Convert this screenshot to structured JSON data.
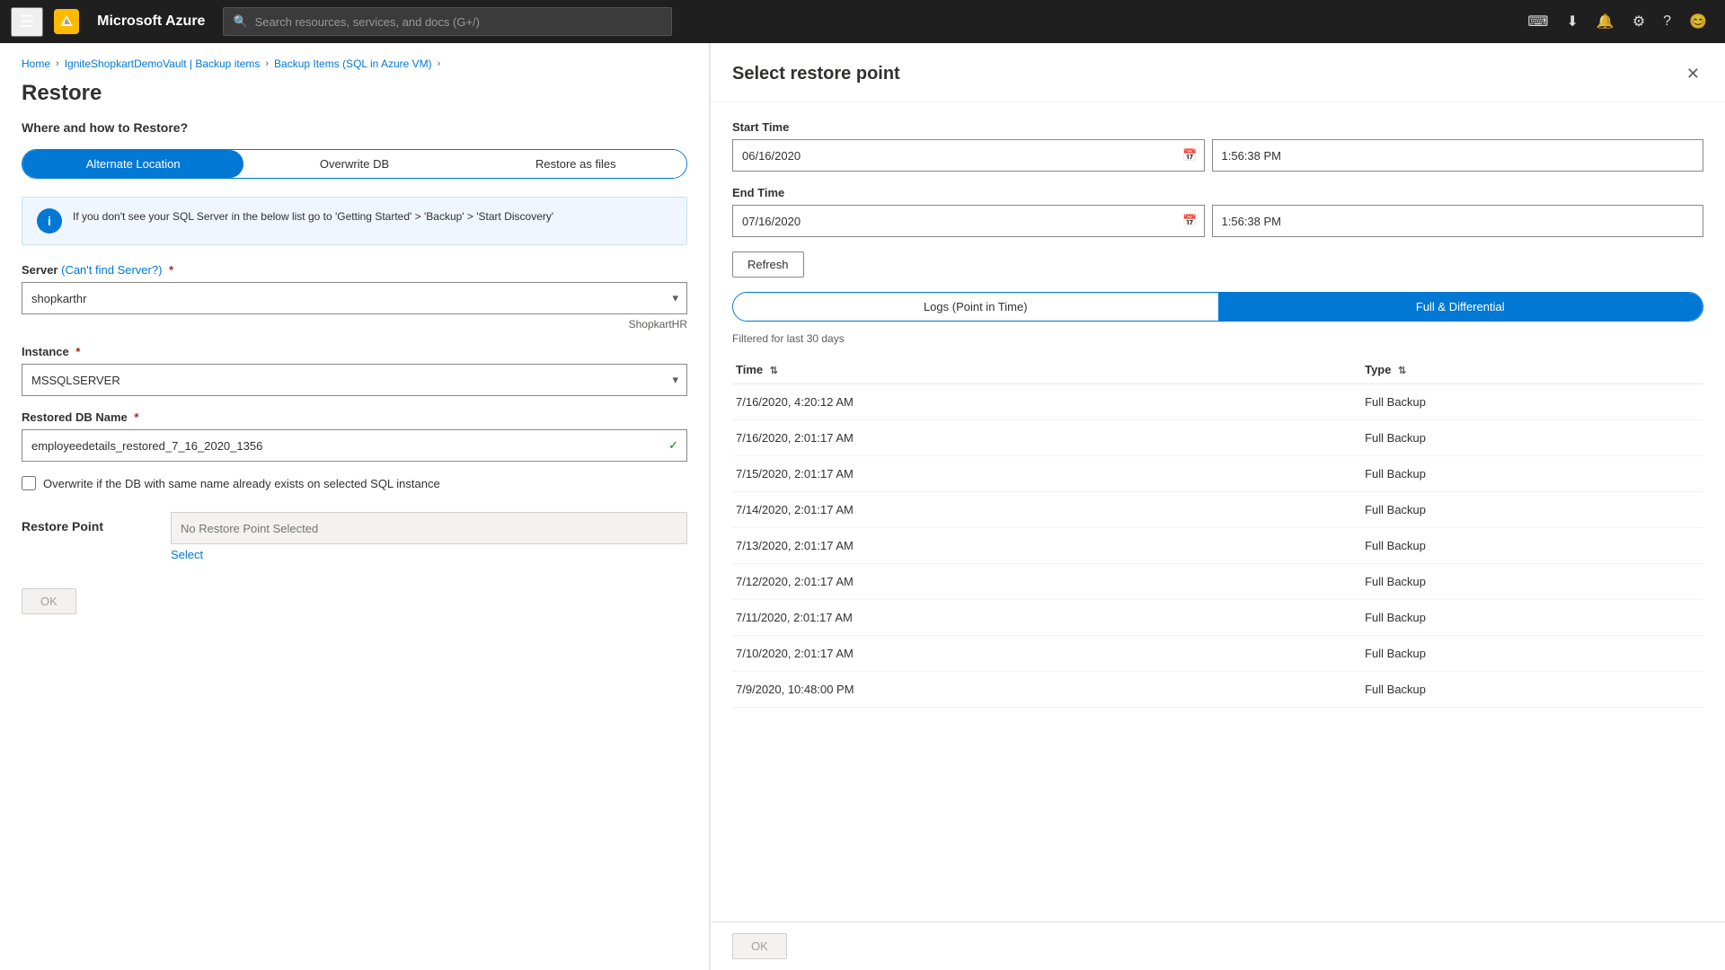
{
  "nav": {
    "hamburger_label": "☰",
    "logo_text": "Microsoft Azure",
    "search_placeholder": "Search resources, services, and docs (G+/)",
    "icons": [
      "⌨",
      "⬇",
      "🔔",
      "⚙",
      "?",
      "😊"
    ]
  },
  "breadcrumb": {
    "items": [
      "Home",
      "IgniteShopkartDemoVault | Backup items",
      "Backup Items (SQL in Azure VM)"
    ]
  },
  "restore": {
    "page_title": "Restore",
    "section_title": "Where and how to Restore?",
    "toggle_options": [
      "Alternate Location",
      "Overwrite DB",
      "Restore as files"
    ],
    "info_text": "If you don't see your SQL Server in the below list go to 'Getting Started' > 'Backup' > 'Start Discovery'",
    "server_label": "Server",
    "server_link": "(Can't find Server?)",
    "server_required": "*",
    "server_value": "shopkarthr",
    "server_hint": "ShopkartHR",
    "instance_label": "Instance",
    "instance_required": "*",
    "instance_value": "MSSQLSERVER",
    "db_name_label": "Restored DB Name",
    "db_name_required": "*",
    "db_name_value": "employeedetails_restored_7_16_2020_1356",
    "checkbox_label": "Overwrite if the DB with same name already exists on selected SQL instance",
    "restore_point_label": "Restore Point",
    "restore_point_placeholder": "No Restore Point Selected",
    "select_link": "Select",
    "ok_label": "OK"
  },
  "panel": {
    "title": "Select restore point",
    "start_time_label": "Start Time",
    "start_date": "06/16/2020",
    "start_time": "1:56:38 PM",
    "end_time_label": "End Time",
    "end_date": "07/16/2020",
    "end_time": "1:56:38 PM",
    "refresh_label": "Refresh",
    "tab_logs": "Logs (Point in Time)",
    "tab_full": "Full & Differential",
    "filter_note": "Filtered for last 30 days",
    "table_headers": [
      "Time",
      "Type"
    ],
    "table_rows": [
      {
        "time": "7/16/2020, 4:20:12 AM",
        "type": "Full Backup"
      },
      {
        "time": "7/16/2020, 2:01:17 AM",
        "type": "Full Backup"
      },
      {
        "time": "7/15/2020, 2:01:17 AM",
        "type": "Full Backup"
      },
      {
        "time": "7/14/2020, 2:01:17 AM",
        "type": "Full Backup"
      },
      {
        "time": "7/13/2020, 2:01:17 AM",
        "type": "Full Backup"
      },
      {
        "time": "7/12/2020, 2:01:17 AM",
        "type": "Full Backup"
      },
      {
        "time": "7/11/2020, 2:01:17 AM",
        "type": "Full Backup"
      },
      {
        "time": "7/10/2020, 2:01:17 AM",
        "type": "Full Backup"
      },
      {
        "time": "7/9/2020, 10:48:00 PM",
        "type": "Full Backup"
      }
    ],
    "ok_label": "OK"
  }
}
